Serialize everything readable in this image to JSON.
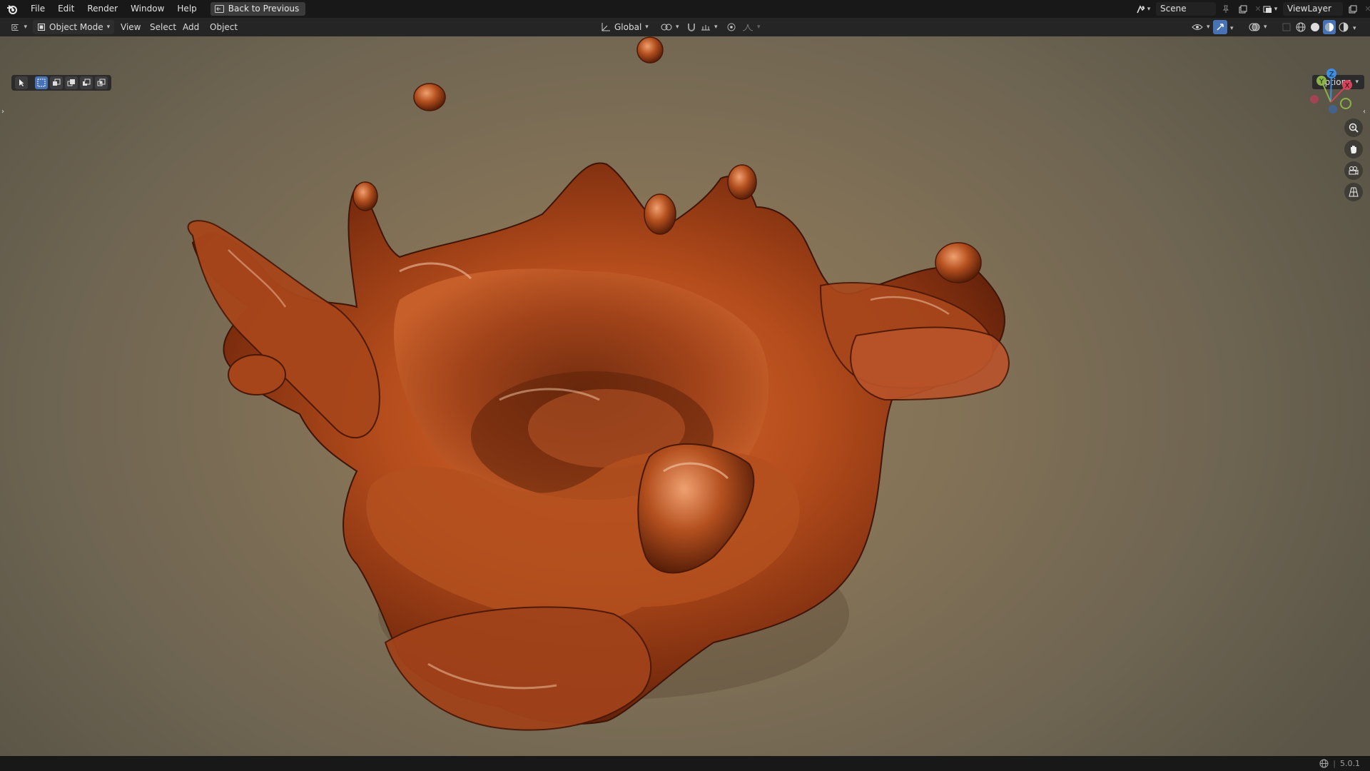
{
  "topbar": {
    "menus": [
      "File",
      "Edit",
      "Render",
      "Window",
      "Help"
    ],
    "back_button": "Back to Previous",
    "scene_name": "Scene",
    "view_layer": "ViewLayer"
  },
  "header": {
    "mode": "Object Mode",
    "menus": [
      "View",
      "Select",
      "Add",
      "Object"
    ],
    "transform_orientation": "Global"
  },
  "viewport": {
    "options_label": "Options",
    "gizmo_axes": [
      "Z",
      "Y",
      "X"
    ],
    "subject": "orange liquid splash crown"
  },
  "statusbar": {
    "version": "5.0.1"
  },
  "colors": {
    "accent": "#4772b3",
    "axis_x": "#d4435a",
    "axis_y": "#8bb34a",
    "axis_z": "#3d8de0"
  }
}
